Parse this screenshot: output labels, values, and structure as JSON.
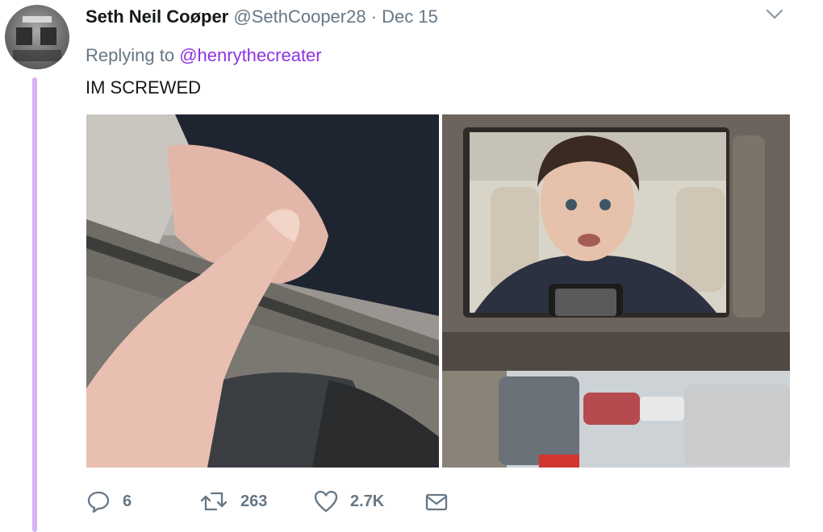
{
  "tweet": {
    "author_name": "Seth Neil Coøper",
    "author_handle": "@SethCooper28",
    "separator": "·",
    "date": "Dec 15",
    "replying_prefix": "Replying to",
    "replying_to": "@henrythecreater",
    "text": "IM SCREWED",
    "menu_icon": "chevron-down-icon",
    "photos": [
      {
        "name": "photo-left",
        "description_icon": "image"
      },
      {
        "name": "photo-right",
        "description_icon": "image"
      }
    ]
  },
  "actions": {
    "reply": {
      "icon": "reply-icon",
      "count": "6"
    },
    "retweet": {
      "icon": "retweet-icon",
      "count": "263"
    },
    "like": {
      "icon": "heart-icon",
      "count": "2.7K"
    },
    "message": {
      "icon": "envelope-icon"
    }
  },
  "colors": {
    "thread_line": "#d7b3f2",
    "mention": "#8f33e0",
    "secondary_text": "#657786"
  }
}
